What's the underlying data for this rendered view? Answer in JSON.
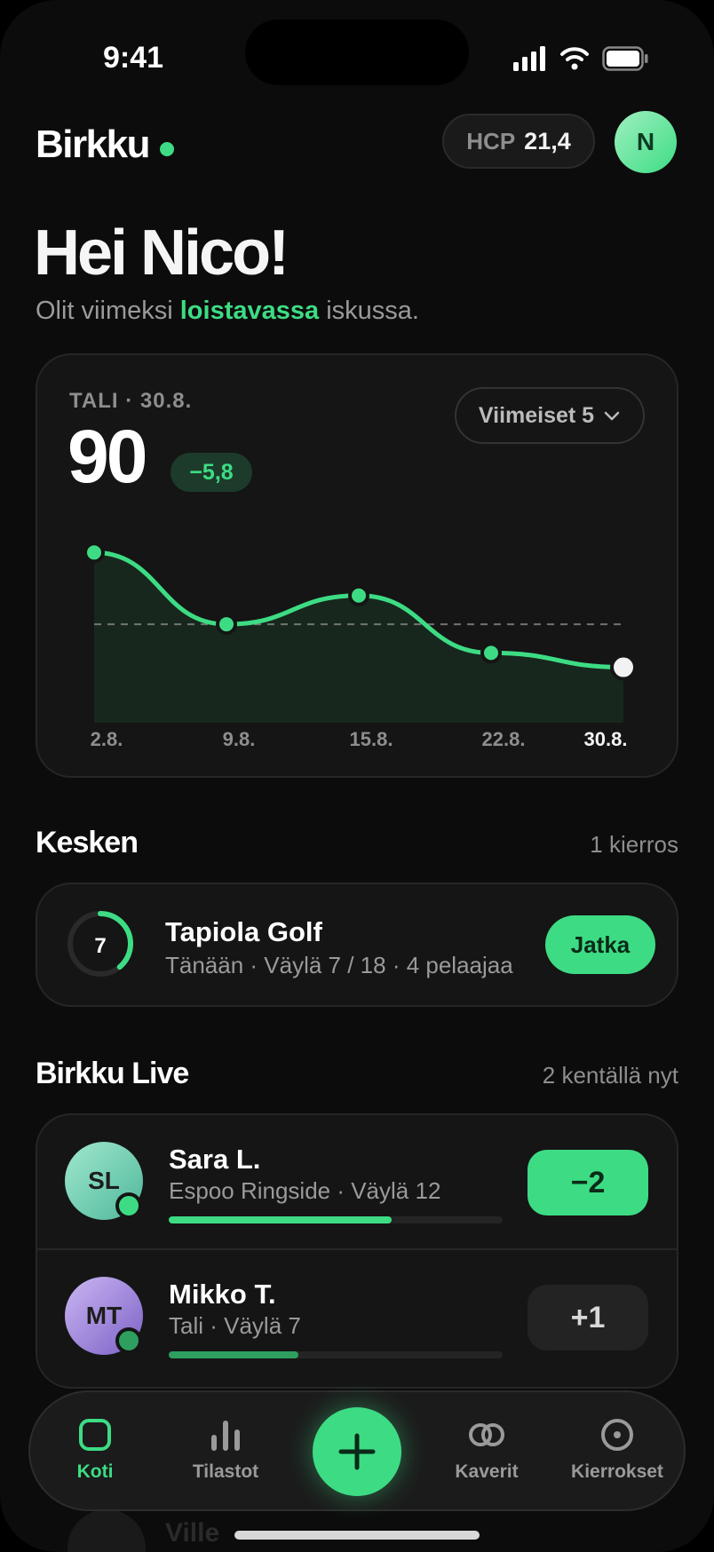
{
  "status_bar": {
    "time": "9:41"
  },
  "header": {
    "logo": "Birkku",
    "hcp_label": "HCP",
    "hcp_value": "21,4",
    "avatar_initial": "N"
  },
  "greeting": {
    "title": "Hei Nico!",
    "subtitle_pre": "Olit viimeksi",
    "subtitle_highlight": "loistavassa",
    "subtitle_post": "iskussa."
  },
  "score_card": {
    "label": "TALI · 30.8.",
    "score": "90",
    "delta": "−5,8",
    "range_button": "Viimeiset 5"
  },
  "chart_data": {
    "type": "area",
    "categories": [
      "2.8.",
      "9.8.",
      "15.8.",
      "22.8.",
      "30.8."
    ],
    "values": [
      106,
      96,
      100,
      92,
      90
    ],
    "reference_line": 96,
    "ylim": [
      84,
      110
    ],
    "highlight_last": true,
    "grid": false
  },
  "in_progress": {
    "title": "Kesken",
    "meta": "1 kierros",
    "round": {
      "hole": "7",
      "progress": 0.3889,
      "course": "Tapiola Golf",
      "detail": "Tänään · Väylä 7 / 18 · 4 pelaajaa",
      "action": "Jatka"
    }
  },
  "live": {
    "title": "Birkku Live",
    "meta": "2 kentällä nyt",
    "players": [
      {
        "initials": "SL",
        "name": "Sara L.",
        "detail": "Espoo Ringside · Väylä 12",
        "progress": 0.667,
        "score": "−2"
      },
      {
        "initials": "MT",
        "name": "Mikko T.",
        "detail": "Tali · Väylä 7",
        "progress": 0.389,
        "score": "+1"
      }
    ],
    "peek_name": "Ville"
  },
  "tabs": [
    {
      "label": "Koti",
      "icon": "home-icon"
    },
    {
      "label": "Tilastot",
      "icon": "stats-icon"
    },
    {
      "label": "",
      "icon": "plus-icon"
    },
    {
      "label": "Kaverit",
      "icon": "friends-icon"
    },
    {
      "label": "Kierrokset",
      "icon": "rounds-icon"
    }
  ],
  "colors": {
    "accent": "#3ddc84",
    "background": "#0c0c0c",
    "card": "#151515"
  }
}
